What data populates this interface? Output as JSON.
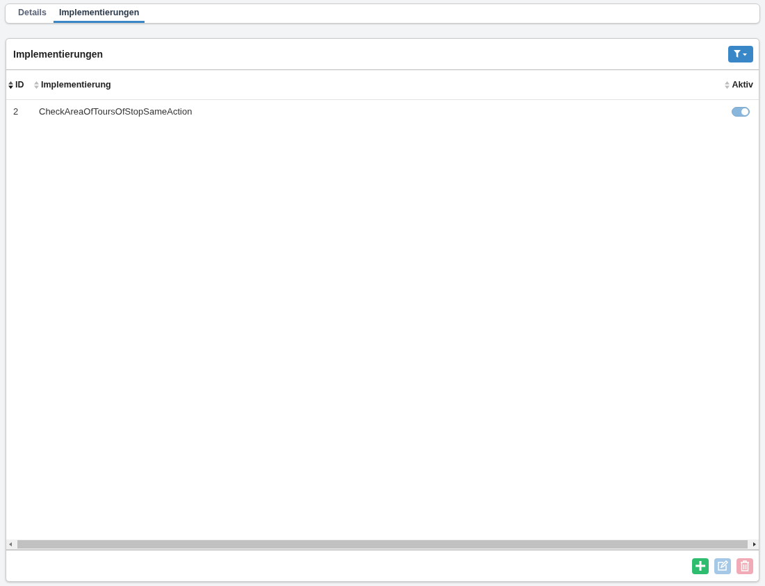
{
  "tabs": [
    {
      "label": "Details",
      "selected": false
    },
    {
      "label": "Implementierungen",
      "selected": true
    }
  ],
  "panel": {
    "title": "Implementierungen"
  },
  "table": {
    "columns": [
      {
        "label": "ID",
        "sorted": true
      },
      {
        "label": "Implementierung",
        "sorted": false
      },
      {
        "label": "Aktiv",
        "sorted": false
      }
    ],
    "rows": [
      {
        "id": "2",
        "implementation": "CheckAreaOfToursOfStopSameAction",
        "active": true,
        "disabled": true
      }
    ]
  },
  "actions": [
    {
      "kind": "add",
      "disabled": false
    },
    {
      "kind": "edit",
      "disabled": true
    },
    {
      "kind": "delete",
      "disabled": true
    }
  ]
}
